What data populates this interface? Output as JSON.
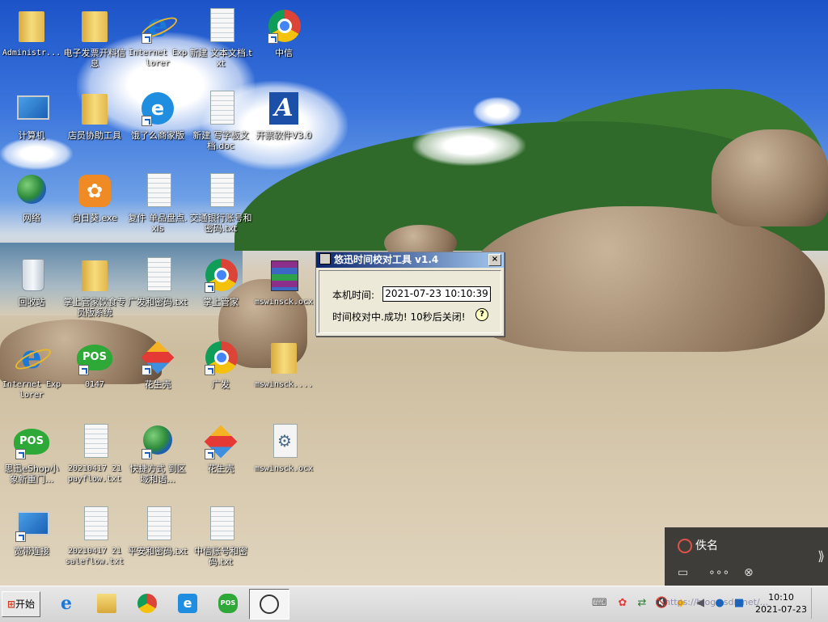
{
  "desktop": {
    "icons": [
      {
        "label": "Administr...",
        "icon": "user-folder-icon"
      },
      {
        "label": "电子发票开料信息",
        "icon": "folder-icon"
      },
      {
        "label": "Internet Explorer",
        "icon": "ie-icon"
      },
      {
        "label": "新建 文本文档.txt",
        "icon": "text-file-icon"
      },
      {
        "label": "中信",
        "icon": "chrome-icon"
      },
      {
        "label": "计算机",
        "icon": "computer-icon"
      },
      {
        "label": "店员协助工具",
        "icon": "folder-icon"
      },
      {
        "label": "饿了么商家版",
        "icon": "eleme-icon"
      },
      {
        "label": "新建 写字板文档.doc",
        "icon": "doc-file-icon"
      },
      {
        "label": "开票软件V3.0",
        "icon": "invoice-app-icon"
      },
      {
        "label": "网络",
        "icon": "network-icon"
      },
      {
        "label": "向日葵.exe",
        "icon": "sunflower-icon"
      },
      {
        "label": "复件 单品盘点.xls",
        "icon": "xls-file-icon"
      },
      {
        "label": "交通银行账号和密码.txt",
        "icon": "text-file-icon"
      },
      {
        "label": "回收站",
        "icon": "recycle-bin-icon"
      },
      {
        "label": "掌上管家饮食专员版系统",
        "icon": "folder-icon"
      },
      {
        "label": "广发和密码.txt",
        "icon": "text-file-icon"
      },
      {
        "label": "掌上管家",
        "icon": "chrome-icon"
      },
      {
        "label": "mswinsck.ocx",
        "icon": "winrar-icon"
      },
      {
        "label": "Internet Explorer",
        "icon": "ie-icon"
      },
      {
        "label": "0147",
        "icon": "pos-icon"
      },
      {
        "label": "花生壳",
        "icon": "peanut-shell-icon"
      },
      {
        "label": "广发",
        "icon": "chrome-icon"
      },
      {
        "label": "mswinsck....",
        "icon": "folder-icon"
      },
      {
        "label": "思迅eShop小象新重门...",
        "icon": "pos-icon"
      },
      {
        "label": "20210417 21 payflow.txt",
        "icon": "text-file-icon"
      },
      {
        "label": "快捷方式 到区域和语...",
        "icon": "globe-clock-icon"
      },
      {
        "label": "花生壳",
        "icon": "peanut-shell-icon"
      },
      {
        "label": "mswinsck.ocx",
        "icon": "ocx-file-icon"
      },
      {
        "label": "宽带连接",
        "icon": "broadband-icon"
      },
      {
        "label": "20210417 21 saleflow.txt",
        "icon": "text-file-icon"
      },
      {
        "label": "平安和密码.txt",
        "icon": "text-file-icon"
      },
      {
        "label": "中信账号和密码.txt",
        "icon": "text-file-icon"
      }
    ]
  },
  "dialog": {
    "title": "悠迅时间校对工具 v1.4",
    "close_label": "×",
    "local_time_label": "本机时间:",
    "local_time_value": "2021-07-23 10:10:39",
    "status_text": "时间校对中.成功! 10秒后关闭!",
    "help_label": "?"
  },
  "notification": {
    "name": "佚名",
    "arrow_label": "⟫"
  },
  "taskbar": {
    "start_label": "开始",
    "start_flag": "⊞",
    "apps": [
      {
        "name": "ie-icon",
        "active": false
      },
      {
        "name": "explorer-icon",
        "active": false
      },
      {
        "name": "chrome-icon",
        "active": false
      },
      {
        "name": "eleme-icon",
        "active": false
      },
      {
        "name": "pos-icon",
        "active": false
      },
      {
        "name": "time-sync-tool-icon",
        "active": true
      }
    ],
    "clock_time": "10:10",
    "clock_date": "2021-07-23"
  },
  "watermark": "https://blog.csdn.net/...",
  "colors": {
    "title_bar_start": "#0a246a",
    "title_bar_end": "#a6caf0",
    "dialog_bg": "#ece9d8"
  }
}
